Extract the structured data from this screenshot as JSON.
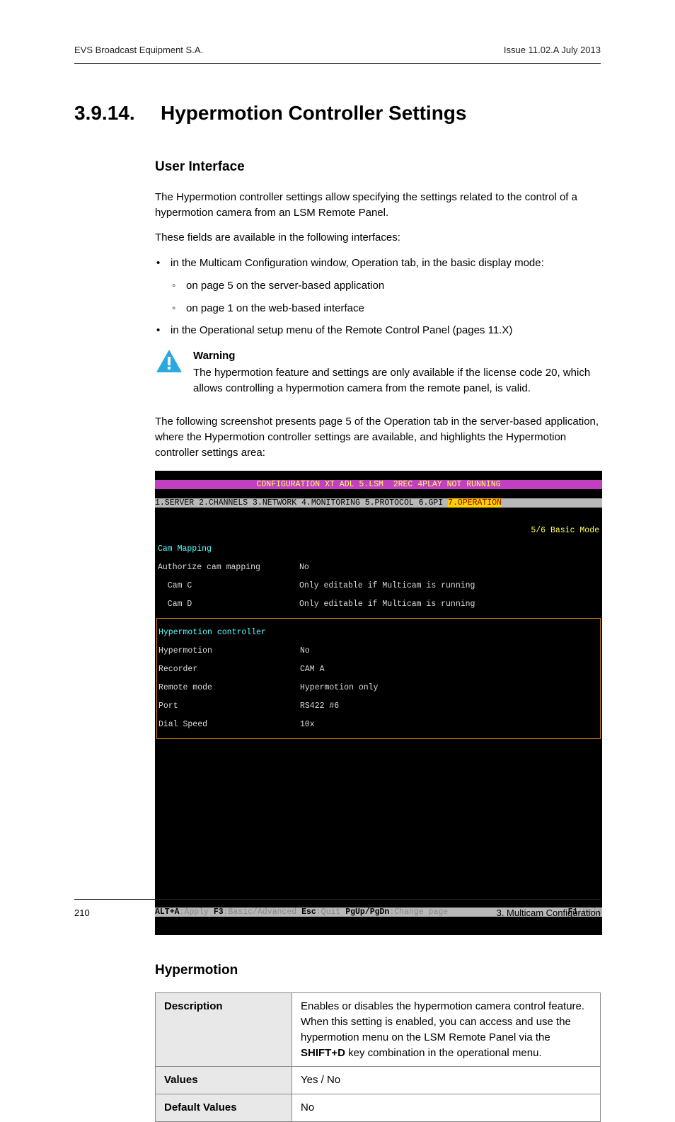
{
  "header": {
    "left": "EVS Broadcast Equipment S.A.",
    "right": "Issue 11.02.A  July 2013"
  },
  "section": {
    "number": "3.9.14.",
    "title": "Hypermotion Controller Settings"
  },
  "h2_1": "User Interface",
  "p1": "The Hypermotion controller settings allow specifying the settings related to the control of a hypermotion camera from an LSM Remote Panel.",
  "p2": "These fields are available in the following interfaces:",
  "li1": "in the Multicam Configuration window, Operation tab, in the basic display mode:",
  "li1a": "on page 5 on the server-based application",
  "li1b": "on page 1 on the web-based interface",
  "li2": "in the Operational setup menu of the Remote Control Panel (pages 11.X)",
  "warning": {
    "title": "Warning",
    "body": "The hypermotion feature and settings are only available if the license code 20, which allows controlling a hypermotion camera from the remote panel, is valid."
  },
  "p3": "The following screenshot presents page 5 of the Operation tab in the server-based application, where the Hypermotion controller settings are available, and highlights the Hypermotion controller settings area:",
  "terminal": {
    "title": "CONFIGURATION XT ADL 5.LSM  2REC 4PLAY NOT RUNNING",
    "tabs_prefix": "1.SERVER 2.CHANNELS 3.NETWORK 4.MONITORING 5.PROTOCOL 6.GPI ",
    "tabs_active": "7.OPERATION",
    "pager": "5/6 Basic Mode",
    "sec1_head": "Cam Mapping",
    "rows1": [
      {
        "k": "Authorize cam mapping",
        "v": "No"
      },
      {
        "k": "  Cam C",
        "v": "Only editable if Multicam is running"
      },
      {
        "k": "  Cam D",
        "v": "Only editable if Multicam is running"
      }
    ],
    "sec2_head": "Hypermotion controller",
    "rows2": [
      {
        "k": "Hypermotion",
        "v": "No"
      },
      {
        "k": "Recorder",
        "v": "CAM A"
      },
      {
        "k": "Remote mode",
        "v": "Hypermotion only"
      },
      {
        "k": "Port",
        "v": "RS422 #6"
      },
      {
        "k": "Dial Speed",
        "v": "10x"
      }
    ],
    "footer": {
      "k1": "ALT+A",
      "v1": ":Apply ",
      "k2": "F3",
      "v2": ":Basic/Advanced ",
      "k3": "Esc",
      "v3": ":Quit ",
      "k4": "PgUp/PgDn",
      "v4": ":Change page",
      "k5": "F1",
      "v5": ":Help"
    }
  },
  "h2_2": "Hypermotion",
  "table": {
    "r1k": "Description",
    "r1v_a": "Enables or disables the hypermotion camera control feature. When this setting is enabled, you can access and use the hypermotion menu on the LSM Remote Panel via the ",
    "r1v_b": "SHIFT+D",
    "r1v_c": " key combination in the operational menu.",
    "r2k": "Values",
    "r2v": "Yes / No",
    "r3k": "Default Values",
    "r3v": "No"
  },
  "footer": {
    "left": "210",
    "right": "3. Multicam Configuration"
  }
}
